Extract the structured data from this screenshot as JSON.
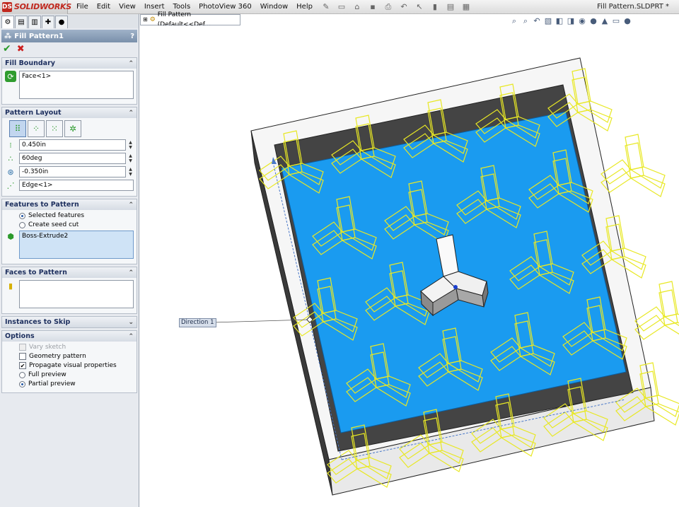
{
  "app": {
    "brand": "SOLIDWORKS",
    "doc_title": "Fill Pattern.SLDPRT *"
  },
  "menu": [
    "File",
    "Edit",
    "View",
    "Insert",
    "Tools",
    "PhotoView 360",
    "Window",
    "Help"
  ],
  "tree": {
    "breadcrumb": "Fill Pattern  (Default<<Def..."
  },
  "pm": {
    "title": "Fill Pattern1",
    "help": "?",
    "groups": {
      "fill_boundary": {
        "title": "Fill Boundary",
        "selection": "Face<1>"
      },
      "pattern_layout": {
        "title": "Pattern Layout",
        "spacing": "0.450in",
        "angle": "60deg",
        "margin": "-0.350in",
        "direction": "Edge<1>"
      },
      "features": {
        "title": "Features to Pattern",
        "opt_selected": "Selected features",
        "opt_seed": "Create seed cut",
        "selection": "Boss-Extrude2"
      },
      "faces": {
        "title": "Faces to Pattern"
      },
      "skip": {
        "title": "Instances to Skip"
      },
      "options": {
        "title": "Options",
        "vary_sketch": "Vary sketch",
        "geometry_pattern": "Geometry pattern",
        "propagate": "Propagate visual properties",
        "full_preview": "Full preview",
        "partial_preview": "Partial preview"
      }
    }
  },
  "viewport": {
    "direction_label": "Direction 1"
  },
  "colors": {
    "face_blue": "#1a9bf0",
    "preview_yellow": "#e8e824",
    "wall_dark": "#3c3c3c",
    "accent": "#c0281e"
  }
}
